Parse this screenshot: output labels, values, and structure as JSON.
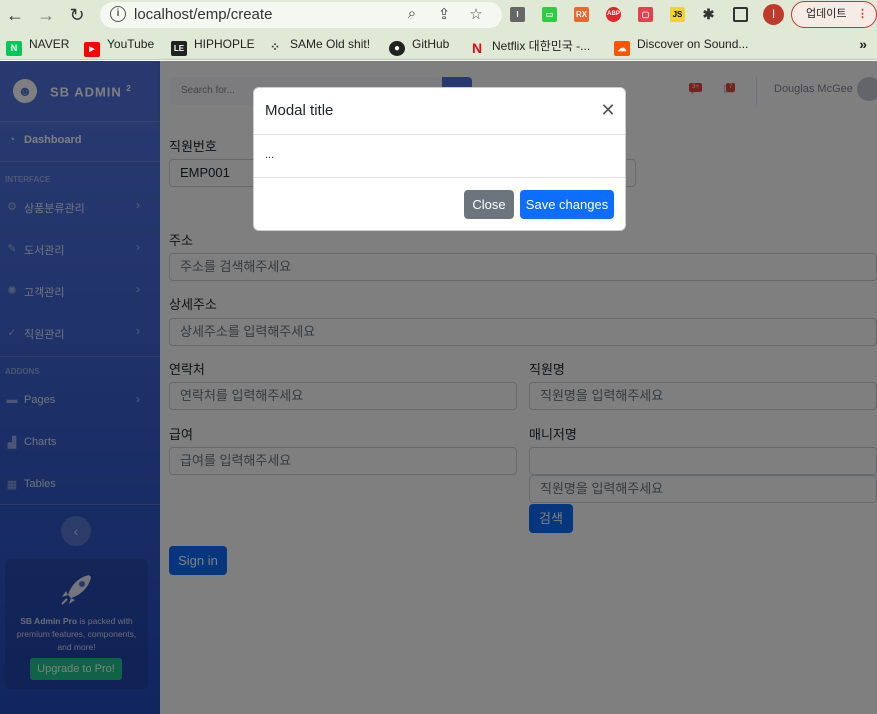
{
  "browser": {
    "url": "localhost/emp/create",
    "update_label": "업데이트",
    "profile_initial": "I",
    "bookmarks": [
      {
        "label": "NAVER",
        "icon": "naver-icon",
        "color": "#03c75a",
        "glyph": "N"
      },
      {
        "label": "YouTube",
        "icon": "youtube-icon",
        "color": "#ff0000",
        "glyph": "▶"
      },
      {
        "label": "HIPHOPLE",
        "icon": "hiphople-icon",
        "color": "#222222",
        "glyph": "LE"
      },
      {
        "label": "SAMe Old shit!",
        "icon": "same-icon",
        "color": "#444444",
        "glyph": "⁘"
      },
      {
        "label": "GitHub",
        "icon": "github-icon",
        "color": "#222222",
        "glyph": "●"
      },
      {
        "label": "Netflix 대한민국 -...",
        "icon": "netflix-icon",
        "color": "#e50914",
        "glyph": "N"
      },
      {
        "label": "Discover on Sound...",
        "icon": "soundcloud-icon",
        "color": "#ff5500",
        "glyph": "☁"
      }
    ]
  },
  "sidebar": {
    "brand": "SB ADMIN",
    "brand_sup": "2",
    "dashboard": "Dashboard",
    "heading_interface": "INTERFACE",
    "heading_addons": "ADDONS",
    "items": [
      {
        "label": "상품분류관리",
        "icon": "cog-icon"
      },
      {
        "label": "도서관리",
        "icon": "wrench-icon"
      },
      {
        "label": "고객관리",
        "icon": "spinner-icon"
      },
      {
        "label": "직원관리",
        "icon": "check-icon"
      },
      {
        "label": "Pages",
        "icon": "folder-icon"
      },
      {
        "label": "Charts",
        "icon": "chart-icon"
      },
      {
        "label": "Tables",
        "icon": "table-icon"
      }
    ],
    "promo_text_bold": "SB Admin Pro",
    "promo_text": " is packed with premium features, components, and more!",
    "promo_button": "Upgrade to Pro!"
  },
  "topbar": {
    "search_placeholder": "Search for...",
    "alerts_badge": "3+",
    "messages_badge": "7",
    "user_name": "Douglas McGee"
  },
  "form": {
    "emp_no_label": "직원번호",
    "emp_no_value": "EMP001",
    "address_label": "주소",
    "address_placeholder": "주소를 검색해주세요",
    "detail_address_label": "상세주소",
    "detail_address_placeholder": "상세주소를 입력해주세요",
    "phone_label": "연락처",
    "phone_placeholder": "연락처를 입력해주세요",
    "name_label": "직원명",
    "name_placeholder": "직원명을 입력해주세요",
    "salary_label": "급여",
    "salary_placeholder": "급여를 입력해주세요",
    "manager_label": "매니저명",
    "manager_value": "",
    "manager_search_placeholder": "직원명을 입력해주세요",
    "search_button": "검색",
    "submit_button": "Sign in"
  },
  "modal": {
    "title": "Modal title",
    "body": "...",
    "close_button": "Close",
    "save_button": "Save changes"
  }
}
